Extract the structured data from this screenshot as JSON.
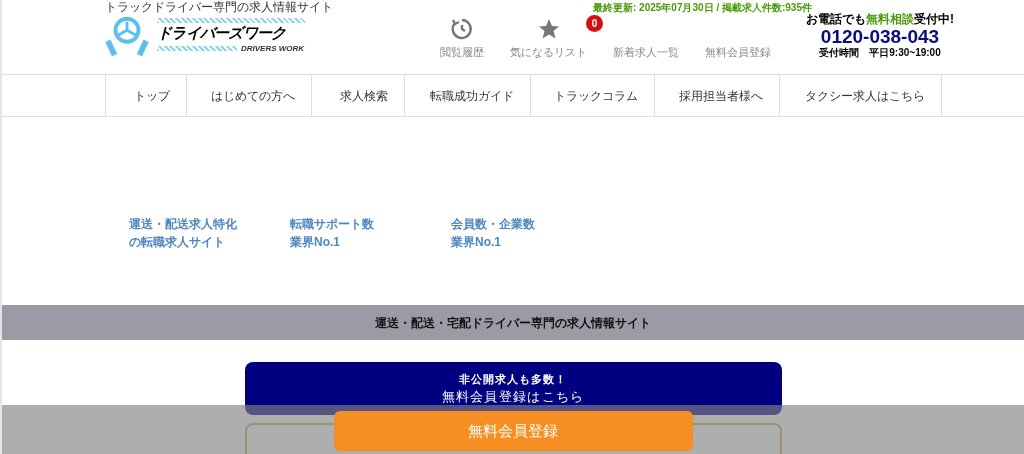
{
  "header": {
    "tagline": "トラックドライバー専門の求人情報サイト",
    "logo": {
      "name": "ドライバーズワーク",
      "sub": "DRIVERS WORK"
    },
    "update": "最終更新: 2025年07月30日 / 掲載求人件数:935件",
    "links": [
      {
        "kind": "history",
        "label": "閲覧履歴"
      },
      {
        "kind": "favorites",
        "label": "気になるリスト",
        "badge": "0"
      },
      {
        "kind": "plain",
        "label": "新着求人一覧"
      },
      {
        "kind": "plain",
        "label": "無料会員登録"
      }
    ],
    "contact": {
      "lead_pre": "お電話でも",
      "lead_em": "無料相談",
      "lead_post": "受付中!",
      "phone": "0120-038-043",
      "hours_label": "受付時間",
      "hours": "平日9:30~19:00"
    }
  },
  "nav": [
    "トップ",
    "はじめての方へ",
    "求人検索",
    "転職成功ガイド",
    "トラックコラム",
    "採用担当者様へ",
    "タクシー求人はこちら"
  ],
  "stats": [
    {
      "line1": "運送・配送求人特化",
      "line2": "の転職求人サイト"
    },
    {
      "line1": "転職サポート数",
      "line2": "業界No.1"
    },
    {
      "line1": "会員数・企業数",
      "line2": "業界No.1"
    }
  ],
  "banner": "運送・配送・宅配ドライバー専門の求人情報サイト",
  "cta": {
    "sub": "非公開求人も多数！",
    "main": "無料会員登録はこちら"
  },
  "bottom_bar": {
    "button": "無料会員登録"
  }
}
